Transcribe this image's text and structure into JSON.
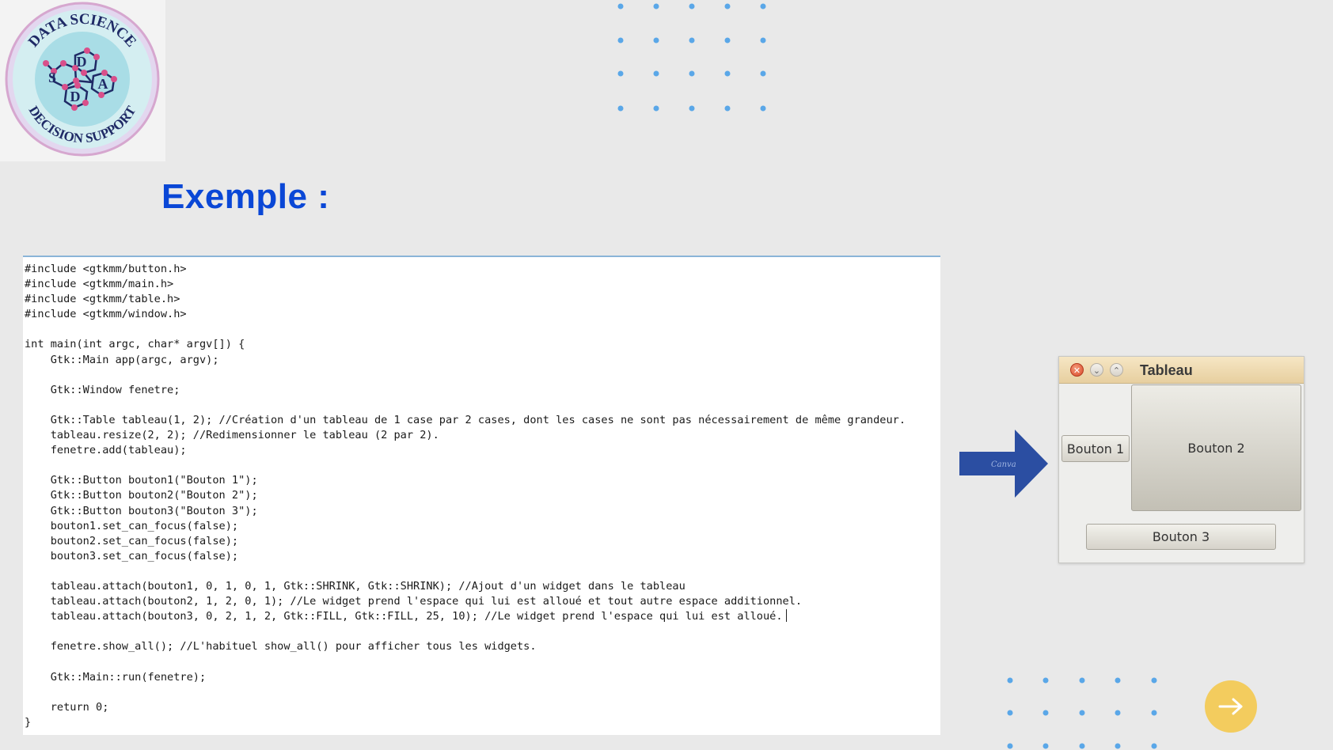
{
  "logo": {
    "text_top": "DATA SCIENCE",
    "text_bottom": "DECISION SUPPORT",
    "letters": [
      "S",
      "D",
      "D",
      "A"
    ]
  },
  "slide": {
    "title": "Exemple :"
  },
  "code": {
    "lines": [
      "#include <gtkmm/button.h>",
      "#include <gtkmm/main.h>",
      "#include <gtkmm/table.h>",
      "#include <gtkmm/window.h>",
      "",
      "int main(int argc, char* argv[]) {",
      "    Gtk::Main app(argc, argv);",
      "",
      "    Gtk::Window fenetre;",
      "",
      "    Gtk::Table tableau(1, 2); //Création d'un tableau de 1 case par 2 cases, dont les cases ne sont pas nécessairement de même grandeur.",
      "    tableau.resize(2, 2); //Redimensionner le tableau (2 par 2).",
      "    fenetre.add(tableau);",
      "",
      "    Gtk::Button bouton1(\"Bouton 1\");",
      "    Gtk::Button bouton2(\"Bouton 2\");",
      "    Gtk::Button bouton3(\"Bouton 3\");",
      "    bouton1.set_can_focus(false);",
      "    bouton2.set_can_focus(false);",
      "    bouton3.set_can_focus(false);",
      "",
      "    tableau.attach(bouton1, 0, 1, 0, 1, Gtk::SHRINK, Gtk::SHRINK); //Ajout d'un widget dans le tableau",
      "    tableau.attach(bouton2, 1, 2, 0, 1); //Le widget prend l'espace qui lui est alloué et tout autre espace additionnel.",
      "    tableau.attach(bouton3, 0, 2, 1, 2, Gtk::FILL, Gtk::FILL, 25, 10); //Le widget prend l'espace qui lui est alloué.",
      "",
      "    fenetre.show_all(); //L'habituel show_all() pour afficher tous les widgets.",
      "",
      "    Gtk::Main::run(fenetre);",
      "",
      "    return 0;",
      "}"
    ],
    "caret_line": 23
  },
  "arrow": {
    "label": "Canva",
    "color": "#2b4ea2"
  },
  "window": {
    "title": "Tableau",
    "close_symbol": "✕",
    "min_symbol": "⌄",
    "max_symbol": "⌃",
    "buttons": {
      "b1": "Bouton 1",
      "b2": "Bouton 2",
      "b3": "Bouton 3"
    }
  },
  "next": {
    "symbol": "→",
    "color": "#f3cc5e"
  },
  "colors": {
    "background": "#e9e9e9",
    "title": "#0a47d6",
    "dots": "#5aa7e8"
  }
}
